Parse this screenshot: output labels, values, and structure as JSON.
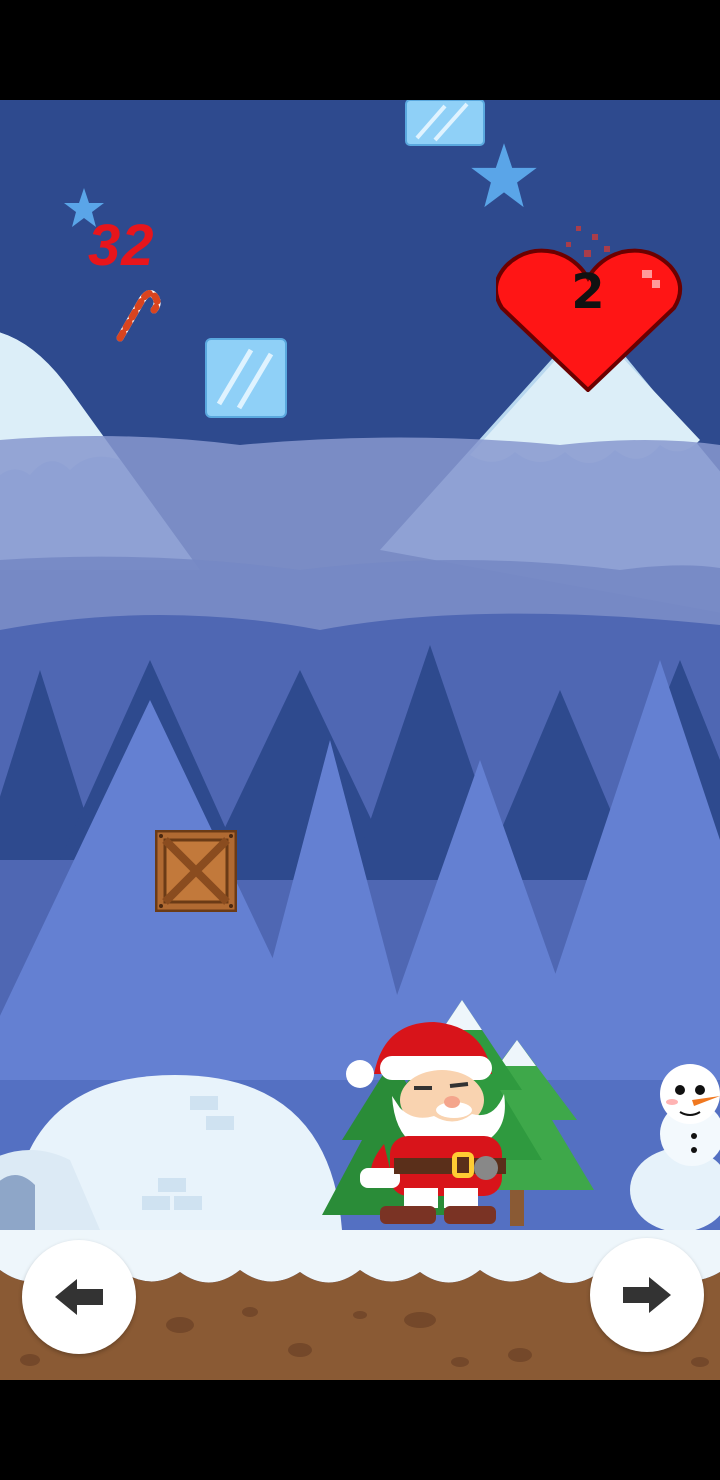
{
  "hud": {
    "score": "32",
    "lives": "2",
    "score_icon": "candy-cane-icon",
    "lives_icon": "heart-icon"
  },
  "controls": {
    "left_icon": "arrow-left-icon",
    "right_icon": "arrow-right-icon"
  },
  "colors": {
    "sky": "#2e4a8e",
    "score_red": "#e8151b",
    "heart_red": "#ff1515",
    "snow": "#eef6fb",
    "dirt": "#8a5a34"
  }
}
